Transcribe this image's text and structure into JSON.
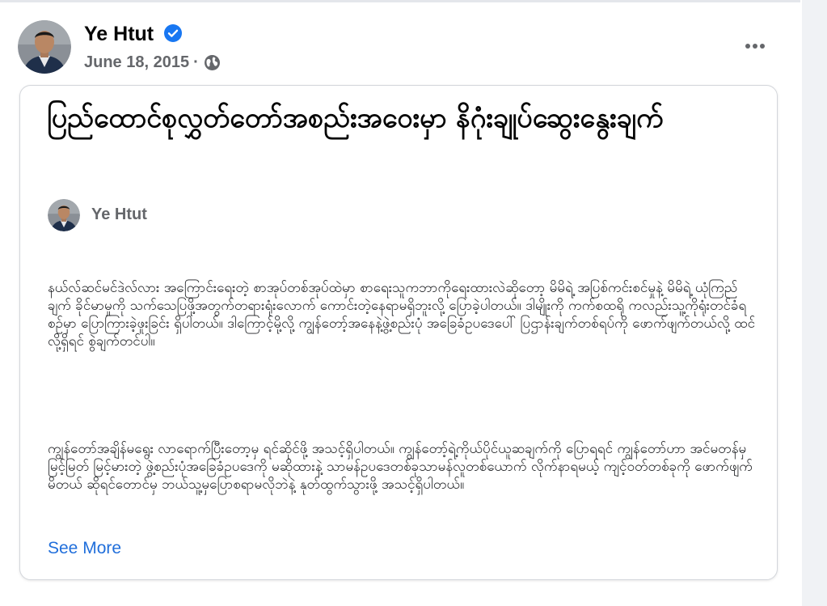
{
  "post": {
    "author_name": "Ye Htut",
    "date": "June 18, 2015",
    "separator": "·",
    "verified_icon": "verified-badge-icon",
    "audience_icon": "globe-icon",
    "more_icon": "more-options-icon"
  },
  "article": {
    "title": "ပြည်ထောင်စုလွှတ်တော်အစည်းအဝေးမှာ နိဂုံးချုပ်ဆွေးနွေးချက်",
    "byline_name": "Ye Htut",
    "paragraphs": [
      "နယ်လ်ဆင်မင်ဒဲလ်လား အကြောင်းရေးတဲ့ စာအုပ်တစ်အုပ်ထဲမှာ စာရေးသူကဘာကိုရေးထားလဲဆိုတော့ မိမိရဲ့ အပြစ်ကင်းစင်မှုနဲ့ မိမိရဲ့ ယုံကြည်ချက် ခိုင်မာမှုကို သက်သေပြဖို့အတွက်တရားရုံးလောက် ကောင်းတဲ့နေရာမရှိဘူးလို့ ပြောခဲ့ပါတယ်။ ဒါမျိုးကို ကက်စထရို ကလည်းသူ့ကိုရုံးတင်ခံရစဉ်မှာ ပြောကြားခဲ့ဖူးခြင်း ရှိပါတယ်။ ဒါကြောင့်မို့လို့ ကျွန်တော့်အနေနဲ့ဖွဲ့စည်းပုံ အခြေခံဥပဒေပေါ် ပြဌာန်းချက်တစ်ရပ်ကို ဖောက်ဖျက်တယ်လို့ ထင်လို့ရှိရင် စွဲချက်တင်ပါ။",
      "ကျွန်တော်အချိန်မရွေး လာရောက်ပြီးတော့မှ ရင်ဆိုင်ဖို့ အသင့်ရှိပါတယ်။ ကျွန်တော့်ရဲ့ကိုယ်ပိုင်ယူဆချက်ကို ပြောရရင် ကျွန်တော်ဟာ အင်မတန်မှ မြင့်မြတ် မြင့်မားတဲ့ ဖွဲ့စည်းပုံအခြေခံဥပဒေကို မဆိုထားနဲ့ သာမန်ဥပဒေတစ်ခုသာမန်လူတစ်ယောက် လိုက်နာရမယ့် ကျင့်ဝတ်တစ်ခုကို ဖောက်ဖျက်မိတယ် ဆိုရင်တောင်မှ ဘယ်သူ့မှပြောစရာမလိုဘဲနဲ့ နုတ်ထွက်သွားဖို့ အသင့်ရှိပါတယ်။"
    ],
    "see_more_label": "See More"
  },
  "colors": {
    "name_text": "#050505",
    "meta_text": "#65676b",
    "verified_blue": "#1877f2",
    "link_blue": "#216fdb",
    "card_border": "#d3d6db",
    "gutter": "#f0f2f5"
  }
}
